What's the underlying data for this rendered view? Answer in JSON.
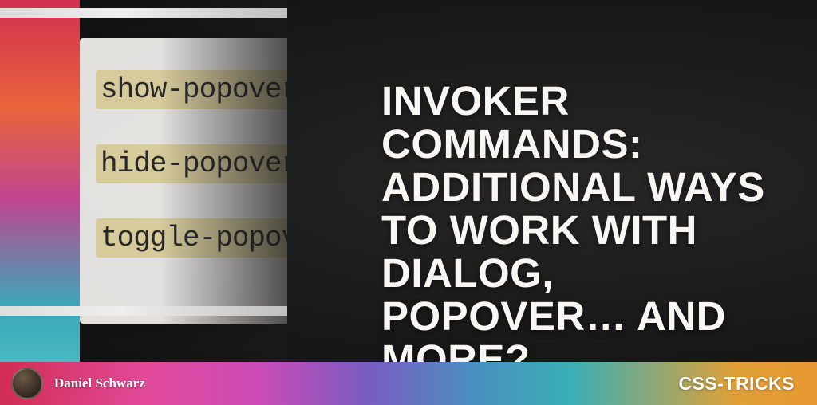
{
  "title": "INVOKER COMMANDS: ADDITIONAL WAYS TO WORK WITH DIALOG, POPOVER… AND MORE?",
  "code_snippet": {
    "line1": "show-popover",
    "line2": "hide-popover",
    "line3": "toggle-popover"
  },
  "author": {
    "name": "Daniel Schwarz"
  },
  "brand": "CSS-TRICKS"
}
